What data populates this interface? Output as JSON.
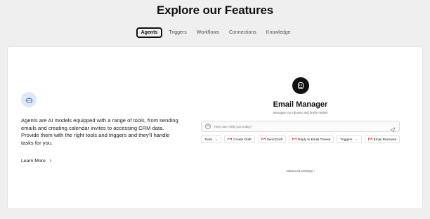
{
  "header": {
    "title": "Explore our Features"
  },
  "tabs": [
    {
      "label": "Agents",
      "active": true
    },
    {
      "label": "Triggers",
      "active": false
    },
    {
      "label": "Workflows",
      "active": false
    },
    {
      "label": "Connections",
      "active": false
    },
    {
      "label": "Knowledge",
      "active": false
    }
  ],
  "feature": {
    "icon": "bot-icon",
    "description": "Agents are AI models equipped with a range of tools, from sending emails and creating calendar invites to accessing CRM data. Provide them with the right tools and triggers and they'll handle tasks for you.",
    "learn_more": "Learn More",
    "learn_more_icon": "chevron-right-icon"
  },
  "preview": {
    "avatar_icon": "robot-avatar-icon",
    "app_title": "Email Manager",
    "app_subtitle": "Manages my inboxes and drafts replies",
    "input_placeholder": "Hey! can I help you today?",
    "pills": {
      "tools_label": "Tools",
      "create_draft": "Create Draft",
      "send_draft": "Send Draft",
      "reply_thread": "Reply to Email Thread",
      "triggers_label": "Triggers",
      "email_received": "Email Received"
    },
    "advanced_settings": "Advanced Settings ›"
  },
  "colors": {
    "page_bg": "#efefef",
    "card_bg": "#ffffff",
    "badge_bg": "#dde9f8",
    "gmail_red": "#ea4335"
  }
}
